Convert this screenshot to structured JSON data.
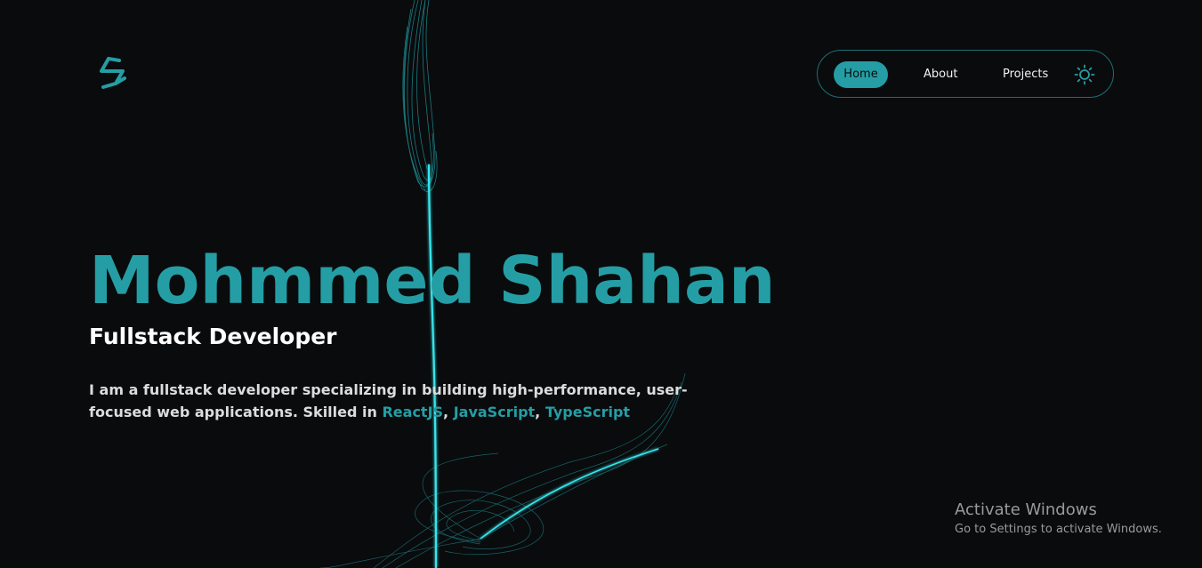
{
  "header": {
    "logo_icon": "s-logo-icon",
    "nav": {
      "home_label": "Home",
      "about_label": "About",
      "projects_label": "Projects",
      "theme_icon": "sun-icon"
    }
  },
  "hero": {
    "name": "Mohmmed Shahan",
    "role": "Fullstack Developer",
    "bio_intro": "I am a fullstack developer specializing in building high-performance, user-focused web applications. Skilled in ",
    "skills": [
      "ReactJS",
      "JavaScript",
      "TypeScript"
    ],
    "separator": ", "
  },
  "watermark": {
    "title": "Activate Windows",
    "subtitle": "Go to Settings to activate Windows."
  },
  "colors": {
    "background": "#0a0b0d",
    "accent": "#249ea4",
    "text": "#ffffff",
    "body_text": "#dcdcdc",
    "glow": "#35e6ec"
  }
}
